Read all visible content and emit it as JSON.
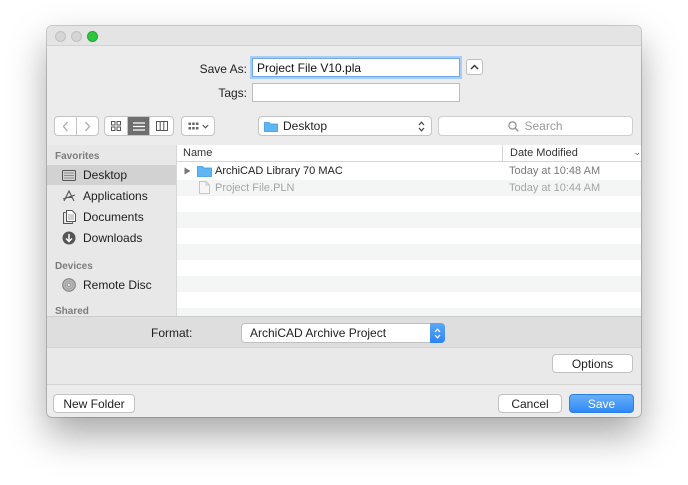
{
  "dialog": {
    "save_as_label": "Save As:",
    "save_as_value": "Project File V10.pla",
    "tags_label": "Tags:",
    "tags_value": ""
  },
  "toolbar": {
    "location_label": "Desktop",
    "search_placeholder": "Search"
  },
  "sidebar": {
    "favorites_heading": "Favorites",
    "favorites": [
      {
        "label": "Desktop",
        "icon": "desktop-icon",
        "selected": true
      },
      {
        "label": "Applications",
        "icon": "applications-icon"
      },
      {
        "label": "Documents",
        "icon": "documents-icon"
      },
      {
        "label": "Downloads",
        "icon": "downloads-icon"
      }
    ],
    "devices_heading": "Devices",
    "devices": [
      {
        "label": "Remote Disc",
        "icon": "disc-icon"
      }
    ],
    "shared_heading": "Shared"
  },
  "file_list": {
    "columns": {
      "name": "Name",
      "date_modified": "Date Modified"
    },
    "rows": [
      {
        "name": "ArchiCAD Library 70 MAC",
        "date": "Today at 10:48 AM",
        "type": "folder"
      },
      {
        "name": "Project File.PLN",
        "date": "Today at 10:44 AM",
        "type": "file",
        "disabled": true
      }
    ]
  },
  "format": {
    "label": "Format:",
    "selected": "ArchiCAD Archive Project"
  },
  "buttons": {
    "options": "Options",
    "new_folder": "New Folder",
    "cancel": "Cancel",
    "save": "Save"
  },
  "colors": {
    "accent": "#2f8af6",
    "folder": "#5fb6f5",
    "zoom_button": "#2bc83f"
  }
}
